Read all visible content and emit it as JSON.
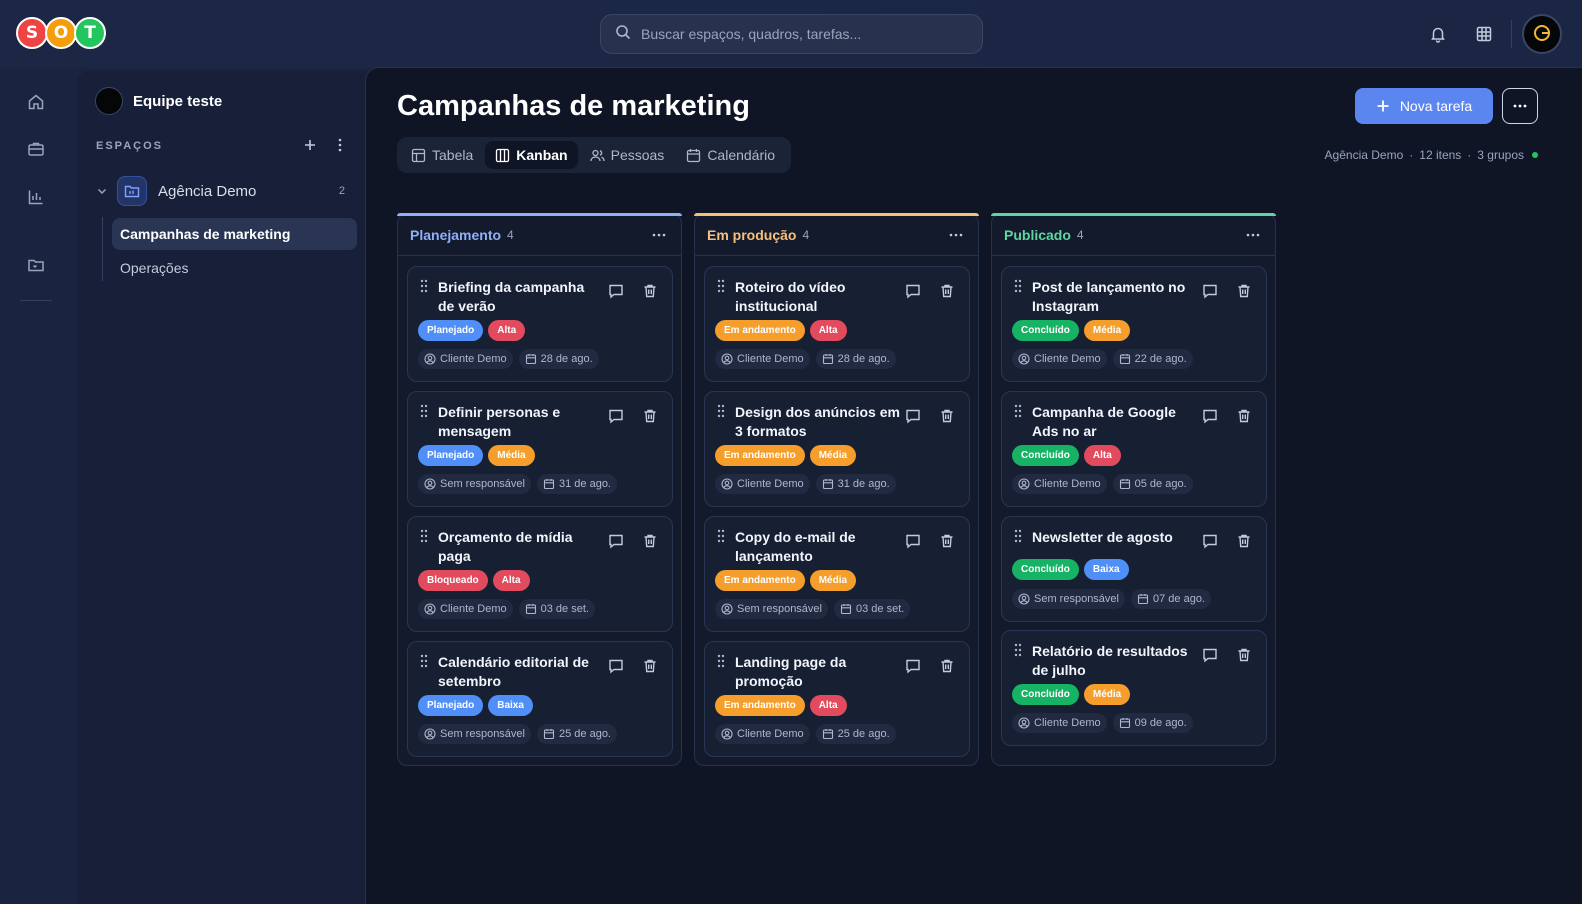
{
  "app": {
    "logo_letters": [
      "S",
      "O",
      "T"
    ],
    "logo_colors": [
      "#ef4444",
      "#f59e0b",
      "#22c55e"
    ],
    "search_placeholder": "Buscar espaços, quadros, tarefas..."
  },
  "sidebar": {
    "team_name": "Equipe teste",
    "section_label": "ESPAÇOS",
    "space": {
      "name": "Agência Demo",
      "count": "2"
    },
    "boards": [
      {
        "label": "Campanhas de marketing",
        "active": true
      },
      {
        "label": "Operações",
        "active": false
      }
    ]
  },
  "header": {
    "title": "Campanhas de marketing",
    "new_button": "Nova tarefa",
    "tabs": [
      {
        "label": "Tabela",
        "icon": "table-icon"
      },
      {
        "label": "Kanban",
        "icon": "kanban-icon"
      },
      {
        "label": "Pessoas",
        "icon": "people-icon"
      },
      {
        "label": "Calendário",
        "icon": "calendar-icon"
      }
    ],
    "meta": {
      "space": "Agência Demo",
      "items": "12 itens",
      "groups": "3 grupos",
      "separator": "·"
    }
  },
  "colors": {
    "accent": "#5b86f0",
    "planejamento": "#8fb0f5",
    "em_producao": "#f6c07a",
    "publicado": "#5fd6a0",
    "tag_blue": "#4f8ff7",
    "tag_red": "#e24a5e",
    "tag_orange": "#f59e2b",
    "tag_green": "#16b364"
  },
  "columns": [
    {
      "title": "Planejamento",
      "count": "4",
      "cards": [
        {
          "title": "Briefing da campanha de verão",
          "tags": [
            {
              "label": "Planejado",
              "color": "blue"
            },
            {
              "label": "Alta",
              "color": "red"
            }
          ],
          "owner": "Cliente Demo",
          "date": "28 de ago."
        },
        {
          "title": "Definir personas e mensagem",
          "tags": [
            {
              "label": "Planejado",
              "color": "blue"
            },
            {
              "label": "Média",
              "color": "orange"
            }
          ],
          "owner": "Sem responsável",
          "date": "31 de ago."
        },
        {
          "title": "Orçamento de mídia paga",
          "tags": [
            {
              "label": "Bloqueado",
              "color": "red"
            },
            {
              "label": "Alta",
              "color": "red"
            }
          ],
          "owner": "Cliente Demo",
          "date": "03 de set."
        },
        {
          "title": "Calendário editorial de setembro",
          "tags": [
            {
              "label": "Planejado",
              "color": "blue"
            },
            {
              "label": "Baixa",
              "color": "blue"
            }
          ],
          "owner": "Sem responsável",
          "date": "25 de ago."
        }
      ]
    },
    {
      "title": "Em produção",
      "count": "4",
      "cards": [
        {
          "title": "Roteiro do vídeo institucional",
          "tags": [
            {
              "label": "Em andamento",
              "color": "orange"
            },
            {
              "label": "Alta",
              "color": "red"
            }
          ],
          "owner": "Cliente Demo",
          "date": "28 de ago."
        },
        {
          "title": "Design dos anúncios em 3 formatos",
          "tags": [
            {
              "label": "Em andamento",
              "color": "orange"
            },
            {
              "label": "Média",
              "color": "orange"
            }
          ],
          "owner": "Cliente Demo",
          "date": "31 de ago."
        },
        {
          "title": "Copy do e-mail de lançamento",
          "tags": [
            {
              "label": "Em andamento",
              "color": "orange"
            },
            {
              "label": "Média",
              "color": "orange"
            }
          ],
          "owner": "Sem responsável",
          "date": "03 de set."
        },
        {
          "title": "Landing page da promoção",
          "tags": [
            {
              "label": "Em andamento",
              "color": "orange"
            },
            {
              "label": "Alta",
              "color": "red"
            }
          ],
          "owner": "Cliente Demo",
          "date": "25 de ago."
        }
      ]
    },
    {
      "title": "Publicado",
      "count": "4",
      "cards": [
        {
          "title": "Post de lançamento no Instagram",
          "tags": [
            {
              "label": "Concluído",
              "color": "green"
            },
            {
              "label": "Média",
              "color": "orange"
            }
          ],
          "owner": "Cliente Demo",
          "date": "22 de ago."
        },
        {
          "title": "Campanha de Google Ads no ar",
          "tags": [
            {
              "label": "Concluído",
              "color": "green"
            },
            {
              "label": "Alta",
              "color": "red"
            }
          ],
          "owner": "Cliente Demo",
          "date": "05 de ago."
        },
        {
          "title": "Newsletter de agosto",
          "tags": [
            {
              "label": "Concluído",
              "color": "green"
            },
            {
              "label": "Baixa",
              "color": "blue"
            }
          ],
          "owner": "Sem responsável",
          "date": "07 de ago."
        },
        {
          "title": "Relatório de resultados de julho",
          "tags": [
            {
              "label": "Concluído",
              "color": "green"
            },
            {
              "label": "Média",
              "color": "orange"
            }
          ],
          "owner": "Cliente Demo",
          "date": "09 de ago."
        }
      ]
    }
  ]
}
